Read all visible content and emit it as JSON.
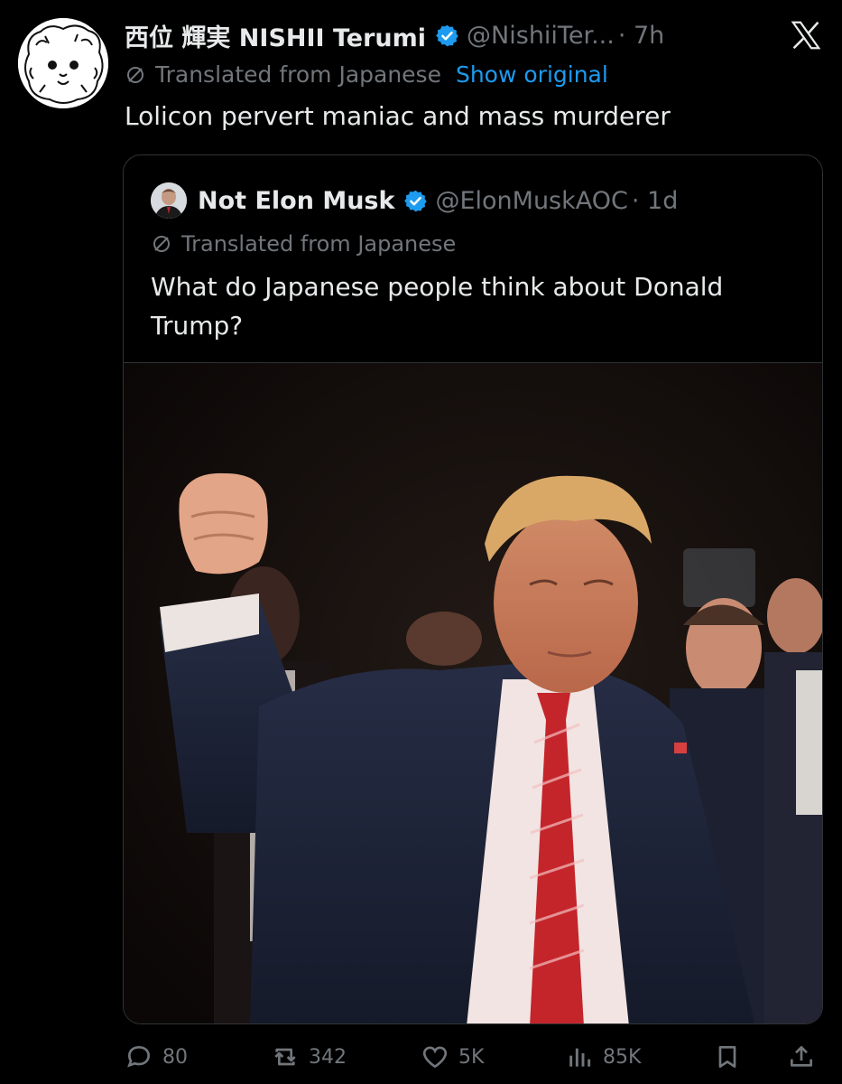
{
  "tweet": {
    "author_name": "西位 輝実 NISHII Terumi",
    "author_handle": "@NishiiTer...",
    "time": "· 7h",
    "translated_label": "Translated from Japanese",
    "show_original_label": "Show original",
    "text": "Lolicon pervert maniac and mass murderer"
  },
  "quoted": {
    "author_name": "Not Elon Musk",
    "author_handle": "@ElonMuskAOC",
    "time": "· 1d",
    "translated_label": "Translated from Japanese",
    "text": "What do Japanese people think about Donald Trump?"
  },
  "actions": {
    "replies": "80",
    "reposts": "342",
    "likes": "5K",
    "views": "85K"
  },
  "colors": {
    "background": "#000000",
    "text": "#e7e9ea",
    "muted": "#71767b",
    "accent": "#1d9bf0",
    "border": "#2f3336"
  },
  "icons": [
    "x-logo-icon",
    "verified-badge-icon",
    "translate-icon",
    "reply-icon",
    "repost-icon",
    "like-icon",
    "views-icon",
    "bookmark-icon",
    "share-icon"
  ]
}
